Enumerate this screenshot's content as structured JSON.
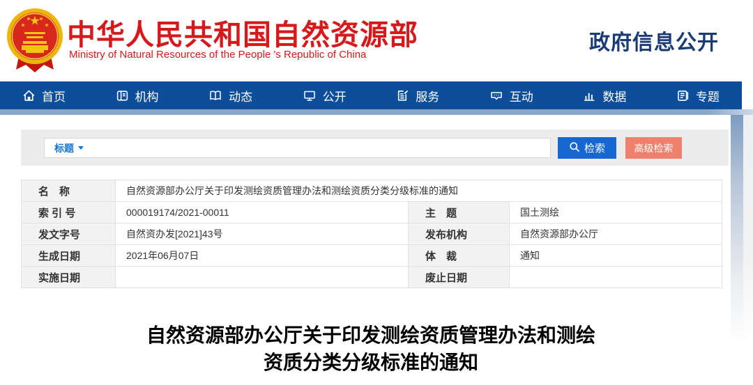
{
  "header": {
    "site_name": "中华人民共和国自然资源部",
    "site_name_en": "Ministry of Natural Resources of the People 's Republic of China",
    "section_title": "政府信息公开"
  },
  "nav": {
    "items": [
      {
        "label": "首页",
        "icon": "home-icon"
      },
      {
        "label": "机构",
        "icon": "organization-icon"
      },
      {
        "label": "动态",
        "icon": "news-icon"
      },
      {
        "label": "公开",
        "icon": "disclosure-icon"
      },
      {
        "label": "服务",
        "icon": "service-icon"
      },
      {
        "label": "互动",
        "icon": "interaction-icon"
      },
      {
        "label": "数据",
        "icon": "data-icon"
      },
      {
        "label": "专题",
        "icon": "topics-icon"
      }
    ]
  },
  "search": {
    "field_selector": "标题",
    "input_value": "",
    "search_button": "检索",
    "advanced_button": "高级检索"
  },
  "meta_table": {
    "name_label": "名　称",
    "name_value": "自然资源部办公厅关于印发测绘资质管理办法和测绘资质分类分级标准的通知",
    "rows": [
      {
        "l1": "索 引 号",
        "v1": "000019174/2021-00011",
        "l2": "主　题",
        "v2": "国土测绘"
      },
      {
        "l1": "发文字号",
        "v1": "自然资办发[2021]43号",
        "l2": "发布机构",
        "v2": "自然资源部办公厅"
      },
      {
        "l1": "生成日期",
        "v1": "2021年06月07日",
        "l2": "体　裁",
        "v2": "通知"
      },
      {
        "l1": "实施日期",
        "v1": "",
        "l2": "废止日期",
        "v2": ""
      }
    ]
  },
  "document": {
    "title_line1": "自然资源部办公厅关于印发测绘资质管理办法和测绘",
    "title_line2": "资质分类分级标准的通知"
  },
  "colors": {
    "accent_red": "#d6191a",
    "nav_blue": "#0d4e9b",
    "nav_strip_blue": "#8ba6c9",
    "section_title_blue": "#1a3b76",
    "search_button_blue": "#1667d1",
    "advanced_button_salmon": "#f0806e",
    "panel_gray": "#ececec",
    "table_label_gray": "#f2f2f2"
  }
}
